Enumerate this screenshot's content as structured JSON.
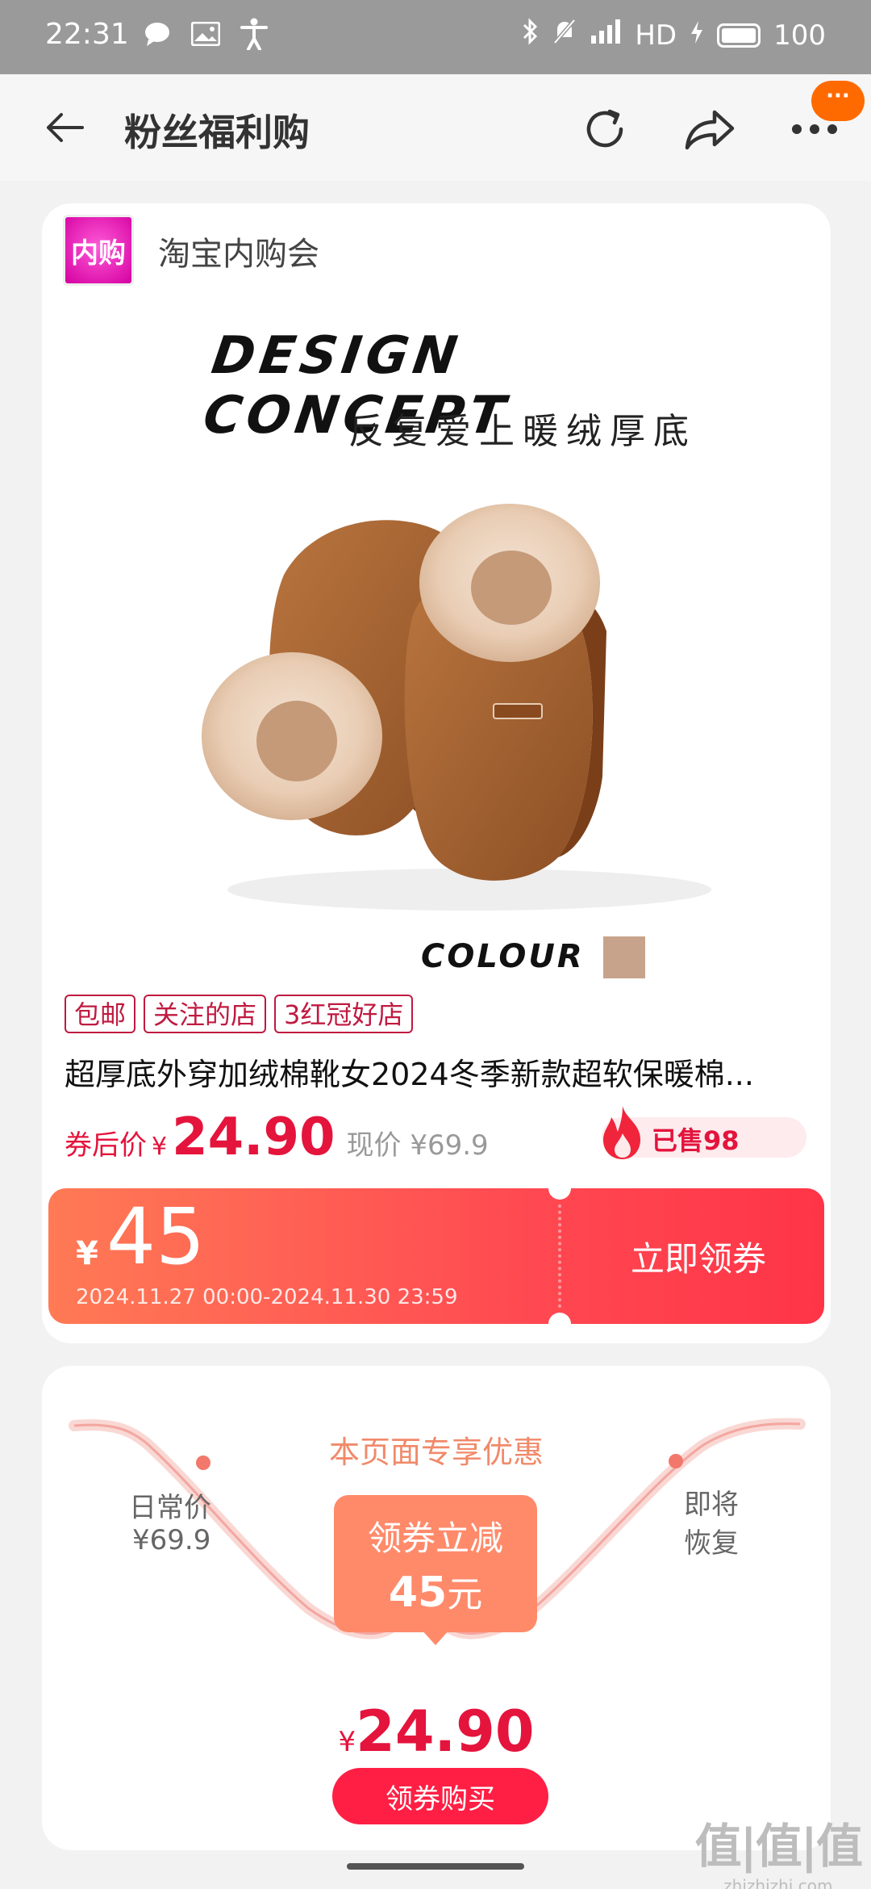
{
  "status_bar": {
    "time": "22:31",
    "network": "HD",
    "battery": "100"
  },
  "nav": {
    "title": "粉丝福利购",
    "badge": "···"
  },
  "shop": {
    "logo_text": "内购",
    "name": "淘宝内购会"
  },
  "hero": {
    "headline": "DESIGN CONCEPT",
    "subtitle": "反复爱上暖绒厚底",
    "colour_label": "COLOUR",
    "swatch_color": "#c7a38b"
  },
  "product": {
    "tags": [
      "包邮",
      "关注的店",
      "3红冠好店"
    ],
    "title": "超厚底外穿加绒棉靴女2024冬季新款超软保暖棉...",
    "after_label": "券后价",
    "currency": "¥",
    "after_price": "24.90",
    "now_price": "现价 ¥69.9",
    "sold": "已售98"
  },
  "coupon": {
    "currency": "¥",
    "amount": "45",
    "validity": "2024.11.27 00:00-2024.11.30 23:59",
    "button": "立即领券"
  },
  "exclusive": {
    "heading": "本页面专享优惠",
    "daily_label": "日常价",
    "daily_price": "¥69.9",
    "soon_label": "即将恢复",
    "promo_line1": "领券立减",
    "promo_amount": "45",
    "promo_unit": "元",
    "final_currency": "¥",
    "final_price": "24.90",
    "buy_button": "领券购买"
  },
  "watermark": {
    "big": "值|值|值",
    "small": "zhizhizhi.com"
  },
  "colors": {
    "accent_red": "#e4143c",
    "orange": "#ff6a00"
  }
}
